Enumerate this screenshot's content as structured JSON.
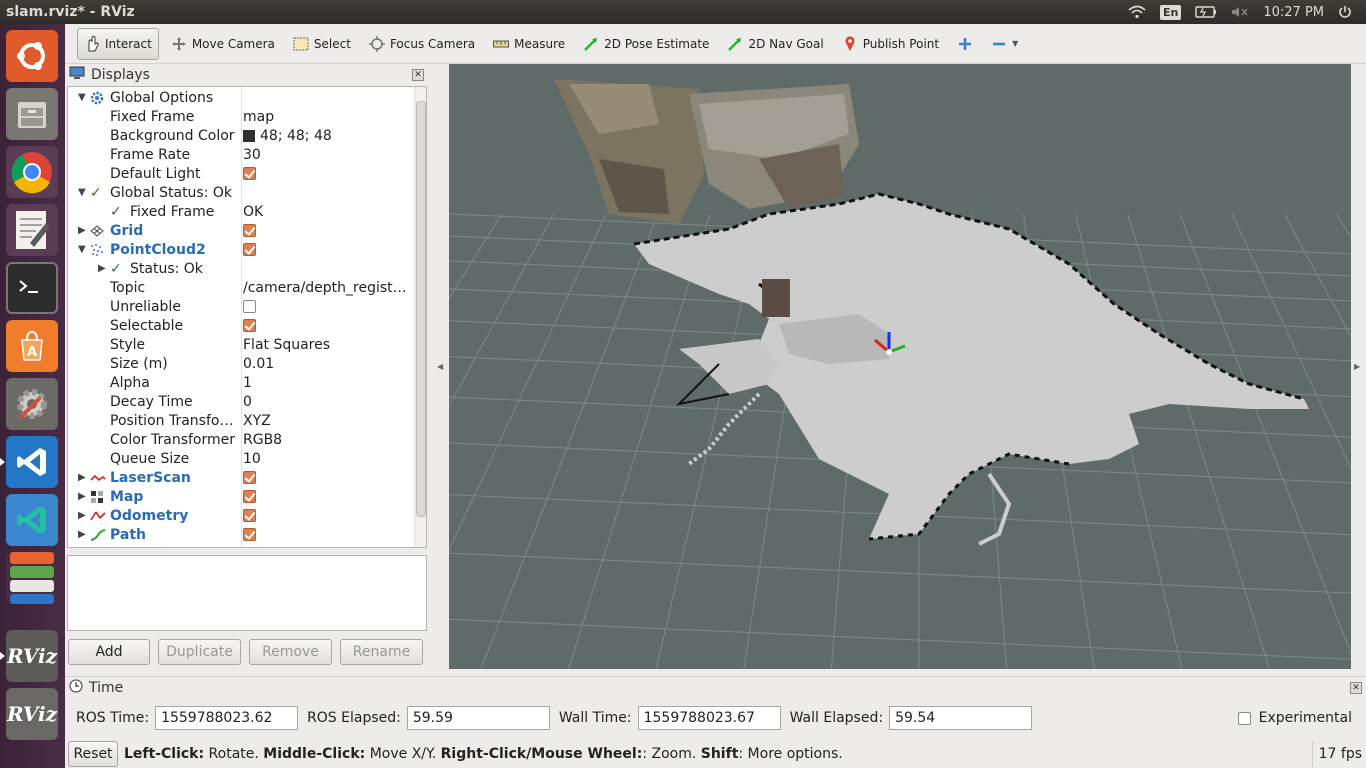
{
  "window": {
    "title": "slam.rviz* - RViz"
  },
  "tray": {
    "lang": "En",
    "time": "10:27 PM"
  },
  "launcher": {
    "items": [
      {
        "name": "Ubuntu",
        "color": "#e05a2b"
      },
      {
        "name": "Files",
        "color": "#6d6a65"
      },
      {
        "name": "Chrome",
        "color": "#2f7ae5"
      },
      {
        "name": "Text Editor",
        "color": "#e9e7e2"
      },
      {
        "name": "Terminal",
        "color": "#2c2c2c"
      },
      {
        "name": "Software Center",
        "color": "#f17d2c"
      },
      {
        "name": "System Settings",
        "color": "#7c7a76"
      },
      {
        "name": "VS Code",
        "color": "#2377c6"
      },
      {
        "name": "VS Code",
        "color": "#3b87cf"
      },
      {
        "name": "Stacked apps",
        "color": "#d0622b"
      },
      {
        "name": "RViz",
        "label": "RViz",
        "color": "#5c5a57"
      },
      {
        "name": "RViz",
        "label": "RViz",
        "color": "#6a6864"
      }
    ]
  },
  "toolbar": {
    "tools": [
      {
        "label": "Interact",
        "icon": "hand-icon",
        "active": true
      },
      {
        "label": "Move Camera",
        "icon": "move-camera-icon"
      },
      {
        "label": "Select",
        "icon": "select-box-icon"
      },
      {
        "label": "Focus Camera",
        "icon": "focus-icon"
      },
      {
        "label": "Measure",
        "icon": "ruler-icon"
      },
      {
        "label": "2D Pose Estimate",
        "icon": "green-arrow-icon"
      },
      {
        "label": "2D Nav Goal",
        "icon": "green-arrow-icon"
      },
      {
        "label": "Publish Point",
        "icon": "pin-icon"
      }
    ],
    "add": "+",
    "remove": "−"
  },
  "displays": {
    "title": "Displays",
    "rows": [
      {
        "depth": 0,
        "name": "Global Options",
        "icon": "gear-icon",
        "expanded": true,
        "value": ""
      },
      {
        "depth": 1,
        "name": "Fixed Frame",
        "value": "map"
      },
      {
        "depth": 1,
        "name": "Background Color",
        "value": "48; 48; 48",
        "swatch": true
      },
      {
        "depth": 1,
        "name": "Frame Rate",
        "value": "30"
      },
      {
        "depth": 1,
        "name": "Default Light",
        "check": true
      },
      {
        "depth": 0,
        "name": "Global Status: Ok",
        "icon": "tick-icon",
        "expanded": true,
        "value": ""
      },
      {
        "depth": 1,
        "name": "Fixed Frame",
        "icon": "tick-icon",
        "value": "OK"
      },
      {
        "depth": 0,
        "name": "Grid",
        "icon": "grid-icon",
        "collapsed": true,
        "blue": true,
        "check": true
      },
      {
        "depth": 0,
        "name": "PointCloud2",
        "icon": "pointcloud-icon",
        "expanded": true,
        "blue": true,
        "check": true
      },
      {
        "depth": 1,
        "name": "Status: Ok",
        "icon": "tick-icon",
        "collapsed": true,
        "value": ""
      },
      {
        "depth": 1,
        "name": "Topic",
        "value": "/camera/depth_regist…"
      },
      {
        "depth": 1,
        "name": "Unreliable",
        "check": false
      },
      {
        "depth": 1,
        "name": "Selectable",
        "check": true
      },
      {
        "depth": 1,
        "name": "Style",
        "value": "Flat Squares"
      },
      {
        "depth": 1,
        "name": "Size (m)",
        "value": "0.01"
      },
      {
        "depth": 1,
        "name": "Alpha",
        "value": "1"
      },
      {
        "depth": 1,
        "name": "Decay Time",
        "value": "0"
      },
      {
        "depth": 1,
        "name": "Position Transfo…",
        "value": "XYZ"
      },
      {
        "depth": 1,
        "name": "Color Transformer",
        "value": "RGB8"
      },
      {
        "depth": 1,
        "name": "Queue Size",
        "value": "10"
      },
      {
        "depth": 0,
        "name": "LaserScan",
        "icon": "laserscan-icon",
        "collapsed": true,
        "blue": true,
        "check": true
      },
      {
        "depth": 0,
        "name": "Map",
        "icon": "map-icon",
        "collapsed": true,
        "blue": true,
        "check": true
      },
      {
        "depth": 0,
        "name": "Odometry",
        "icon": "odometry-icon",
        "collapsed": true,
        "blue": true,
        "check": true
      },
      {
        "depth": 0,
        "name": "Path",
        "icon": "path-icon",
        "collapsed": true,
        "blue": true,
        "check": true
      }
    ],
    "buttons": {
      "add": "Add",
      "duplicate": "Duplicate",
      "remove": "Remove",
      "rename": "Rename"
    }
  },
  "time": {
    "title": "Time",
    "ros_time_label": "ROS Time:",
    "ros_time": "1559788023.62",
    "ros_elapsed_label": "ROS Elapsed:",
    "ros_elapsed": "59.59",
    "wall_time_label": "Wall Time:",
    "wall_time": "1559788023.67",
    "wall_elapsed_label": "Wall Elapsed:",
    "wall_elapsed": "59.54",
    "experimental": "Experimental"
  },
  "status": {
    "reset": "Reset",
    "k1": "Left-Click:",
    "t1": " Rotate. ",
    "k2": "Middle-Click:",
    "t2": " Move X/Y. ",
    "k3": "Right-Click/Mouse Wheel:",
    "t3": ": Zoom. ",
    "k4": "Shift",
    "t4": ": More options.",
    "fps": "17 fps"
  },
  "colors": {
    "viewport_bg": "#303030",
    "grid": "#a0a0a0",
    "map_free": "#cdcdcd",
    "accent_blue": "#2a6bb3"
  }
}
